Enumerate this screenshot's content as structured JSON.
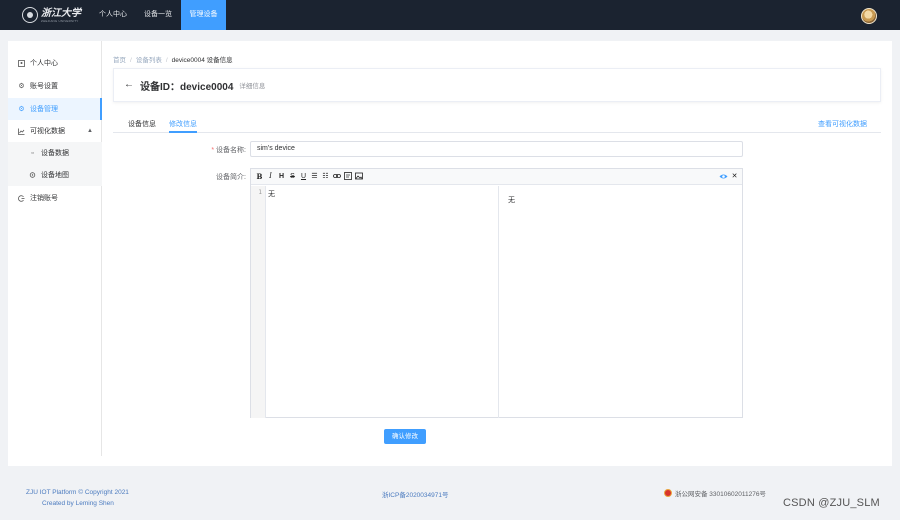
{
  "topnav": {
    "logo_text": "浙江大学",
    "logo_sub": "ZHEJIANG UNIVERSITY",
    "items": [
      {
        "label": "个人中心"
      },
      {
        "label": "设备一览"
      },
      {
        "label": "管理设备",
        "active": true
      }
    ]
  },
  "sidebar": {
    "items": [
      {
        "label": "个人中心",
        "icon": "user-square-icon"
      },
      {
        "label": "账号设置",
        "icon": "gear-icon"
      },
      {
        "label": "设备管理",
        "icon": "gear-icon",
        "active": true
      },
      {
        "label": "可视化数据",
        "icon": "chart-icon",
        "expanded": true
      },
      {
        "label": "设备数据",
        "icon": "data-icon",
        "sub": true
      },
      {
        "label": "设备地图",
        "icon": "location-icon",
        "sub": true
      },
      {
        "label": "注销账号",
        "icon": "logout-icon"
      }
    ]
  },
  "breadcrumb": [
    "首页",
    "设备列表",
    "device0004 设备信息"
  ],
  "header": {
    "title": "设备ID：device0004",
    "subtitle": "详细信息"
  },
  "tabs": [
    {
      "label": "设备信息"
    },
    {
      "label": "修改信息",
      "active": true
    }
  ],
  "tab_link": "查看可视化数据",
  "form": {
    "name_label": "设备名称:",
    "name_value": "sim's device",
    "desc_label": "设备简介:",
    "editor_content": "无",
    "preview_content": "无",
    "line_number": "1",
    "toolbar": [
      "B",
      "I",
      "H",
      "S",
      "U",
      "ul-list",
      "ol-list",
      "link",
      "code",
      "image",
      "preview",
      "fullscreen"
    ],
    "submit_label": "确认修改"
  },
  "footer": {
    "platform": "ZJU IOT Platform © Copyright 2021",
    "author": "Created by Leming Shen",
    "icp": "浙ICP备2020034971号",
    "police": "浙公网安备 33010602011276号"
  },
  "watermark": "CSDN @ZJU_SLM",
  "colors": {
    "accent": "#409eff",
    "topbar": "#1b2330",
    "background": "#f0f2f5"
  }
}
